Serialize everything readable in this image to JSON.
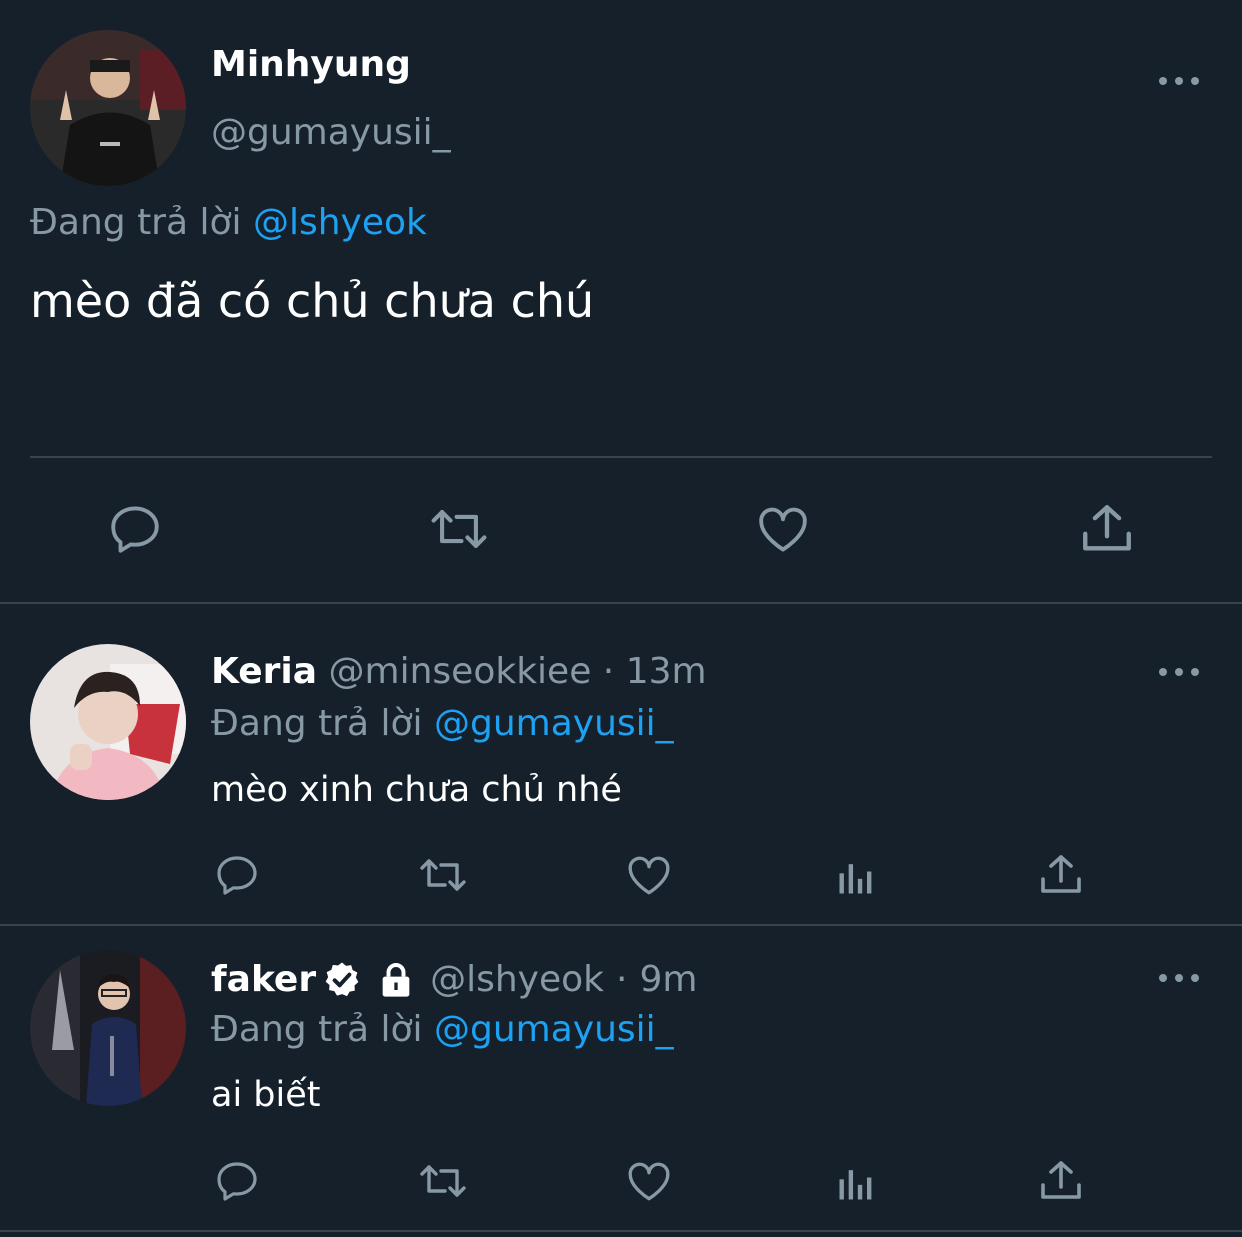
{
  "main_tweet": {
    "display_name": "Minhyung",
    "handle": "@gumayusii_",
    "replying_prefix": "Đang trả lời",
    "replying_to": "@lshyeok",
    "text": "mèo đã có chủ chưa chú",
    "actions": [
      "reply-icon",
      "retweet-icon",
      "like-icon",
      "share-icon"
    ]
  },
  "replies": [
    {
      "display_name": "Keria",
      "handle": "@minseokkiee",
      "separator": "·",
      "time": "13m",
      "replying_prefix": "Đang trả lời",
      "replying_to": "@gumayusii_",
      "text": "mèo xinh chưa chủ nhé",
      "actions": [
        "reply-icon",
        "retweet-icon",
        "like-icon",
        "analytics-icon",
        "share-icon"
      ]
    },
    {
      "display_name": "faker",
      "verified": true,
      "protected": true,
      "handle": "@lshyeok",
      "separator": "·",
      "time": "9m",
      "replying_prefix": "Đang trả lời",
      "replying_to": "@gumayusii_",
      "text": "ai biết",
      "actions": [
        "reply-icon",
        "retweet-icon",
        "like-icon",
        "analytics-icon",
        "share-icon"
      ]
    }
  ],
  "colors": {
    "background": "#15202b",
    "muted": "#8899a6",
    "link": "#1da1f2",
    "divider": "#38444d"
  }
}
